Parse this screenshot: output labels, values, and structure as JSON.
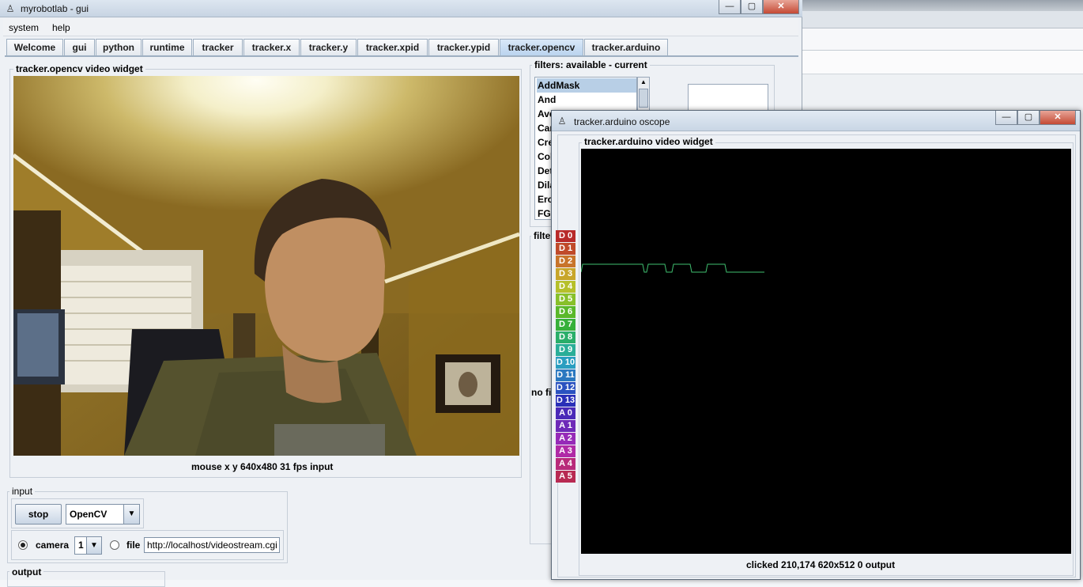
{
  "main_window": {
    "title": "myrobotlab - gui",
    "controls": {
      "minimize": "—",
      "maximize": "▢",
      "close": "✕"
    }
  },
  "menu": [
    "system",
    "help"
  ],
  "tabs": [
    "Welcome",
    "gui",
    "python",
    "runtime",
    "tracker",
    "tracker.x",
    "tracker.y",
    "tracker.xpid",
    "tracker.ypid",
    "tracker.opencv",
    "tracker.arduino"
  ],
  "active_tab": "tracker.opencv",
  "video_widget": {
    "label": "tracker.opencv  video widget",
    "caption": "mouse x y  640x480  31 fps  input"
  },
  "input": {
    "label": "input",
    "stop_button": "stop",
    "grabber_select": "OpenCV",
    "camera_label": "camera",
    "camera_index": "1",
    "file_label": "file",
    "file_url": "http://localhost/videostream.cgi",
    "camera_selected": true
  },
  "output": {
    "label": "output"
  },
  "filters": {
    "label": "filters: available - current",
    "available": [
      "AddMask",
      "And",
      "Ave",
      "Can",
      "Cre",
      "Col",
      "Det",
      "Dila",
      "Ero",
      "FGE"
    ],
    "selected": "AddMask",
    "lower_label": "filte",
    "none_text": "no fi"
  },
  "oscope_window": {
    "title": "tracker.arduino oscope",
    "controls": {
      "minimize": "—",
      "maximize": "▢",
      "close": "✕"
    },
    "video_label": "tracker.arduino  video widget",
    "caption": "clicked 210,174  620x512  0  output",
    "pins": [
      {
        "label": "D 0",
        "color": "#b82a2a"
      },
      {
        "label": "D 1",
        "color": "#c04a2a"
      },
      {
        "label": "D 2",
        "color": "#c8742a"
      },
      {
        "label": "D 3",
        "color": "#c8a62a"
      },
      {
        "label": "D 4",
        "color": "#b6c02a"
      },
      {
        "label": "D 5",
        "color": "#88c02a"
      },
      {
        "label": "D 6",
        "color": "#5ab82a"
      },
      {
        "label": "D 7",
        "color": "#36b03a"
      },
      {
        "label": "D 8",
        "color": "#2aae6a"
      },
      {
        "label": "D 9",
        "color": "#2aae98"
      },
      {
        "label": "D 10",
        "color": "#2a9ec0"
      },
      {
        "label": "D 11",
        "color": "#2a78c0"
      },
      {
        "label": "D 12",
        "color": "#2a52c0"
      },
      {
        "label": "D 13",
        "color": "#2a30b8"
      },
      {
        "label": "A 0",
        "color": "#4a2ab8"
      },
      {
        "label": "A 1",
        "color": "#6e2ab8"
      },
      {
        "label": "A 2",
        "color": "#962ab8"
      },
      {
        "label": "A 3",
        "color": "#b02aa6"
      },
      {
        "label": "A 4",
        "color": "#b82a7a"
      },
      {
        "label": "A 5",
        "color": "#b82a52"
      }
    ],
    "trace_color": "#3fbf6f"
  }
}
